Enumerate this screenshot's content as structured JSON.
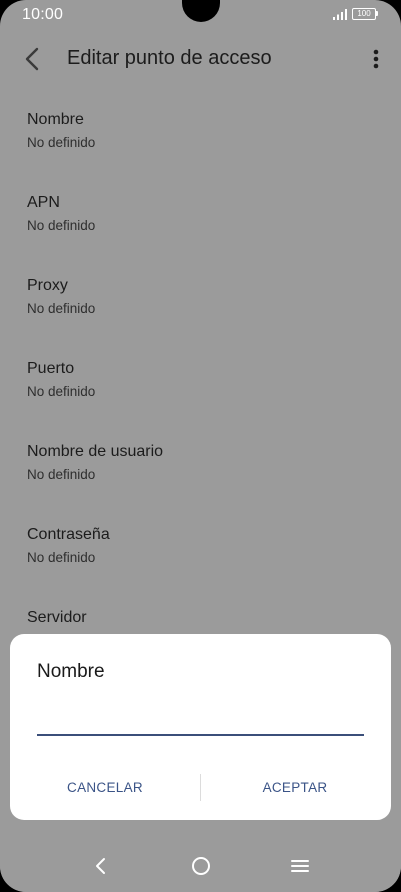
{
  "status_bar": {
    "time": "10:00",
    "battery_level": "100",
    "icons": [
      "signal-icon",
      "battery-icon"
    ]
  },
  "app_bar": {
    "title": "Editar punto de acceso",
    "back_icon": "chevron-left-icon",
    "more_icon": "more-vert-icon"
  },
  "settings": [
    {
      "title": "Nombre",
      "summary": "No definido"
    },
    {
      "title": "APN",
      "summary": "No definido"
    },
    {
      "title": "Proxy",
      "summary": "No definido"
    },
    {
      "title": "Puerto",
      "summary": "No definido"
    },
    {
      "title": "Nombre de usuario",
      "summary": "No definido"
    },
    {
      "title": "Contraseña",
      "summary": "No definido"
    },
    {
      "title": "Servidor",
      "summary": ""
    }
  ],
  "dialog": {
    "title": "Nombre",
    "input_value": "",
    "cancel_label": "CANCELAR",
    "accept_label": "ACEPTAR"
  },
  "nav_bar": {
    "icons": [
      "back-icon",
      "home-icon",
      "recents-icon"
    ]
  },
  "colors": {
    "scrim_background": "#9b9b9b",
    "dialog_background": "#ffffff",
    "accent": "#3b5487",
    "input_underline": "#3b4f7a"
  }
}
